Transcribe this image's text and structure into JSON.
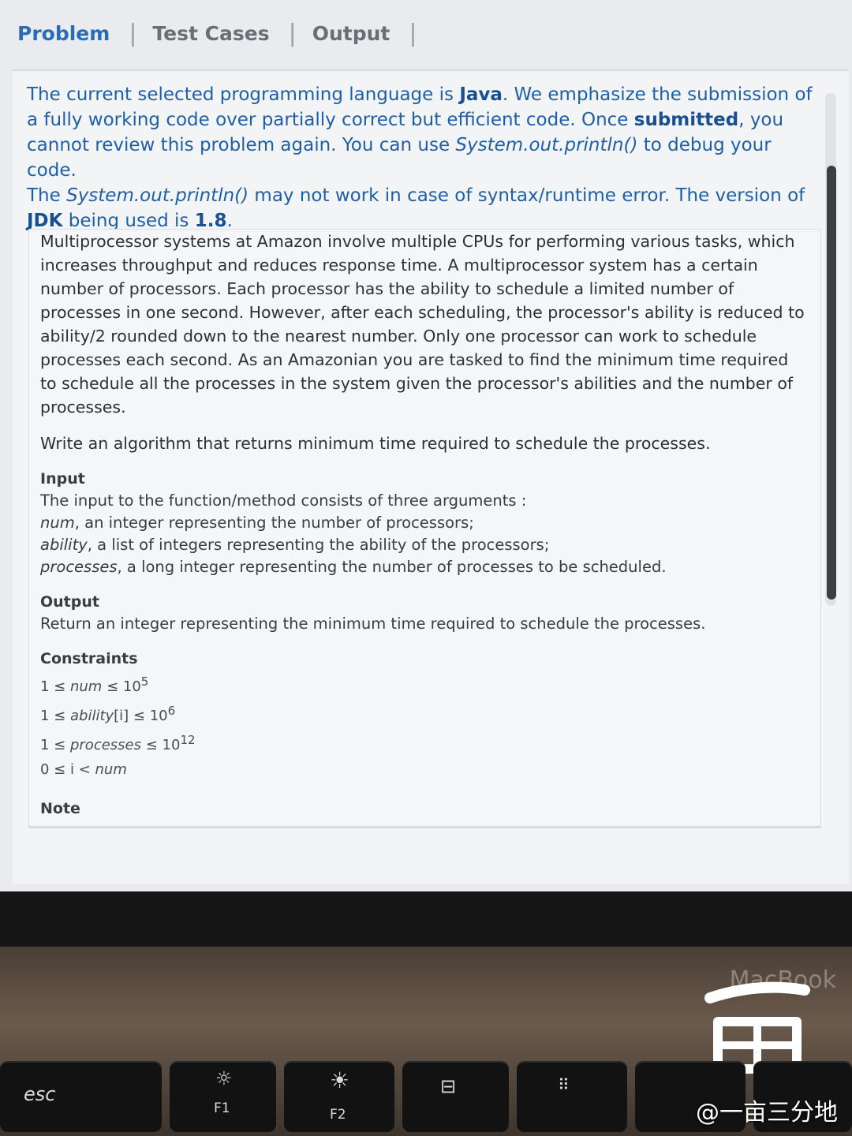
{
  "tabs": [
    {
      "label": "Problem"
    },
    {
      "label": "Test Cases"
    },
    {
      "label": "Output"
    }
  ],
  "notice": {
    "t1": "The current selected programming language is ",
    "lang": "Java",
    "t2": ". We emphasize the submission of a fully working code over partially correct but efficient code. Once ",
    "submitted": "submitted",
    "t3": ", you cannot review this problem again. You can use ",
    "println1": "System.out.println()",
    "t4": " to debug your code.",
    "t5": "The ",
    "println2": "System.out.println()",
    "t6": " may not work in case of syntax/runtime error. The version of ",
    "jdk": "JDK",
    "t7": " being used is ",
    "version": "1.8",
    "t8": "."
  },
  "description": "Multiprocessor systems at Amazon involve multiple CPUs for performing various tasks, which increases throughput and reduces response time. A multiprocessor system has a certain number of processors. Each processor has the ability to schedule a limited number of processes in one second. However, after each scheduling, the processor's ability is reduced to ability/2 rounded down to the nearest number. Only one processor can work to schedule processes each second. As an Amazonian you are tasked to find the minimum time required to schedule all the processes in the system given the processor's abilities and the number of processes.",
  "task": "Write an algorithm that returns minimum time required to schedule the processes.",
  "input": {
    "title": "Input",
    "intro": "The input to the function/method consists of three arguments :",
    "arg1_name": "num",
    "arg1_desc": ", an integer representing the number of processors;",
    "arg2_name": "ability",
    "arg2_desc": ", a list of integers representing the ability of the processors;",
    "arg3_name": "processes",
    "arg3_desc": ", a long integer representing the number of processes to be scheduled."
  },
  "output": {
    "title": "Output",
    "body": "Return an integer representing the minimum time required to schedule the processes."
  },
  "constraints": {
    "title": "Constraints",
    "c1_pre": "1 ≤ ",
    "c1_var": "num",
    "c1_post": " ≤ 10",
    "c1_exp": "5",
    "c2_pre": "1 ≤ ",
    "c2_var": "ability",
    "c2_idx": "[i]",
    "c2_post": " ≤ 10",
    "c2_exp": "6",
    "c3_pre": "1 ≤ ",
    "c3_var": "processes",
    "c3_post": " ≤ 10",
    "c3_exp": "12",
    "c4_pre": "0 ≤ i < ",
    "c4_var": "num"
  },
  "note": {
    "title": "Note"
  },
  "device": {
    "brand": "MacBook",
    "keys": {
      "esc": "esc",
      "f1": "F1",
      "f2": "F2"
    }
  },
  "watermark": "@一亩三分地"
}
